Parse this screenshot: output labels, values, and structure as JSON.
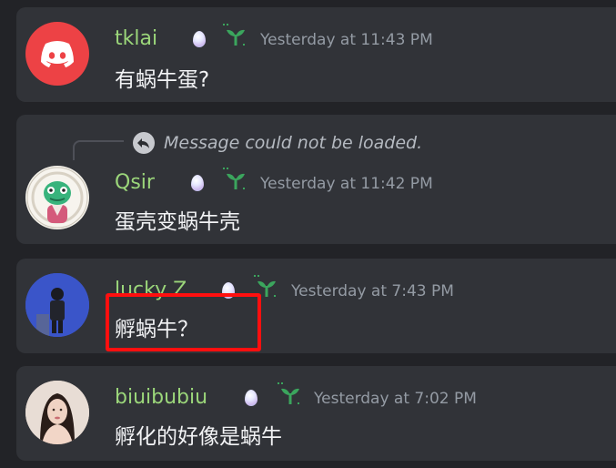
{
  "messages": [
    {
      "author": "tklai",
      "author_color": "#9bd67a",
      "timestamp": "Yesterday at 11:43 PM",
      "text": "有蜗牛蛋?",
      "avatar": "discord-logo-icon"
    },
    {
      "reply": "Message could not be loaded.",
      "author": "Qsir",
      "author_color": "#9bd67a",
      "timestamp": "Yesterday at 11:42 PM",
      "text": "蛋壳变蜗牛壳",
      "avatar": "chameleon-avatar"
    },
    {
      "author": "lucky Z",
      "author_color": "#9bd67a",
      "timestamp": "Yesterday at 7:43 PM",
      "text": "孵蜗牛？",
      "avatar": "person-avatar"
    },
    {
      "author": "biuibubiu",
      "author_color": "#9bd67a",
      "timestamp": "Yesterday at 7:02 PM",
      "text": "孵化的好像是蜗牛",
      "avatar": "photo-avatar"
    }
  ],
  "colors": {
    "background": "#222327",
    "card": "#313338",
    "highlight": "#ff0f0f",
    "discord_red": "#ed4245",
    "sprout_green": "#3ba55d"
  }
}
